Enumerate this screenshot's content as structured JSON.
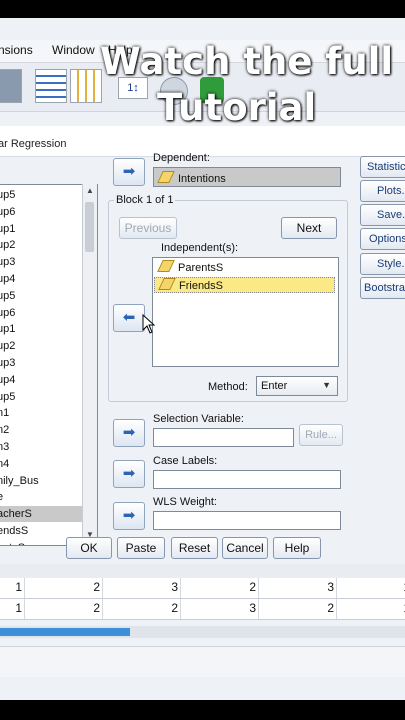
{
  "watermark": {
    "line1": "Watch the full",
    "line2": "Tutorial"
  },
  "menubar": {
    "items": [
      "nsions",
      "Window",
      "Help"
    ]
  },
  "dialog": {
    "title": "ar Regression",
    "variables": [
      "up5",
      "up6",
      "up1",
      "up2",
      "up3",
      "up4",
      "up5",
      "up6",
      "up1",
      "up2",
      "up3",
      "up4",
      "up5",
      "n1",
      "n2",
      "n3",
      "n4",
      "nily_Bus",
      "e",
      "acherS",
      "endsS",
      "entsS"
    ],
    "selected_variable": "acherS",
    "dependent": {
      "label": "Dependent:",
      "value": "Intentions"
    },
    "block": {
      "label": "Block 1 of 1",
      "previous": "Previous",
      "next": "Next"
    },
    "independents": {
      "label": "Independent(s):",
      "items": [
        "ParentsS",
        "FriendsS"
      ],
      "selected": "FriendsS"
    },
    "method": {
      "label": "Method:",
      "value": "Enter"
    },
    "selection_variable": {
      "label": "Selection Variable:",
      "rule": "Rule..."
    },
    "case_labels": {
      "label": "Case Labels:"
    },
    "wls_weight": {
      "label": "WLS Weight:"
    },
    "side_buttons": [
      "Statistics",
      "Plots...",
      "Save...",
      "Options",
      "Style...",
      "Bootstrap"
    ],
    "bottom_buttons": [
      "OK",
      "Paste",
      "Reset",
      "Cancel",
      "Help"
    ]
  },
  "data_rows": [
    [
      "1",
      "2",
      "3",
      "2",
      "3",
      "1"
    ],
    [
      "1",
      "2",
      "2",
      "3",
      "2",
      "1"
    ]
  ]
}
